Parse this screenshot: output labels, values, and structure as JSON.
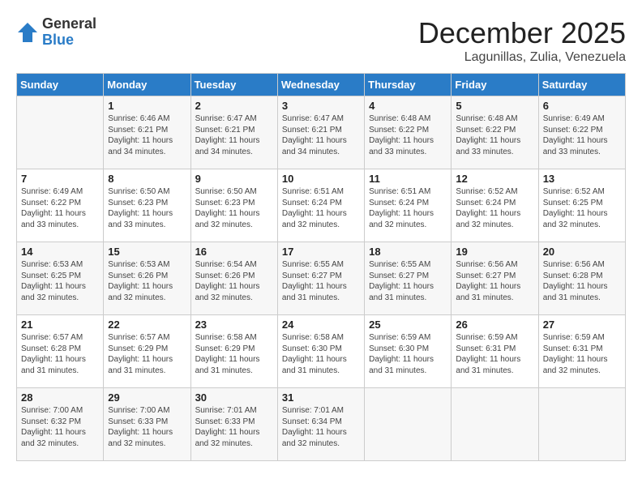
{
  "header": {
    "logo": {
      "general": "General",
      "blue": "Blue"
    },
    "title": "December 2025",
    "location": "Lagunillas, Zulia, Venezuela"
  },
  "calendar": {
    "days_of_week": [
      "Sunday",
      "Monday",
      "Tuesday",
      "Wednesday",
      "Thursday",
      "Friday",
      "Saturday"
    ],
    "weeks": [
      [
        {
          "day": "",
          "info": ""
        },
        {
          "day": "1",
          "info": "Sunrise: 6:46 AM\nSunset: 6:21 PM\nDaylight: 11 hours and 34 minutes."
        },
        {
          "day": "2",
          "info": "Sunrise: 6:47 AM\nSunset: 6:21 PM\nDaylight: 11 hours and 34 minutes."
        },
        {
          "day": "3",
          "info": "Sunrise: 6:47 AM\nSunset: 6:21 PM\nDaylight: 11 hours and 34 minutes."
        },
        {
          "day": "4",
          "info": "Sunrise: 6:48 AM\nSunset: 6:22 PM\nDaylight: 11 hours and 33 minutes."
        },
        {
          "day": "5",
          "info": "Sunrise: 6:48 AM\nSunset: 6:22 PM\nDaylight: 11 hours and 33 minutes."
        },
        {
          "day": "6",
          "info": "Sunrise: 6:49 AM\nSunset: 6:22 PM\nDaylight: 11 hours and 33 minutes."
        }
      ],
      [
        {
          "day": "7",
          "info": "Sunrise: 6:49 AM\nSunset: 6:22 PM\nDaylight: 11 hours and 33 minutes."
        },
        {
          "day": "8",
          "info": "Sunrise: 6:50 AM\nSunset: 6:23 PM\nDaylight: 11 hours and 33 minutes."
        },
        {
          "day": "9",
          "info": "Sunrise: 6:50 AM\nSunset: 6:23 PM\nDaylight: 11 hours and 32 minutes."
        },
        {
          "day": "10",
          "info": "Sunrise: 6:51 AM\nSunset: 6:24 PM\nDaylight: 11 hours and 32 minutes."
        },
        {
          "day": "11",
          "info": "Sunrise: 6:51 AM\nSunset: 6:24 PM\nDaylight: 11 hours and 32 minutes."
        },
        {
          "day": "12",
          "info": "Sunrise: 6:52 AM\nSunset: 6:24 PM\nDaylight: 11 hours and 32 minutes."
        },
        {
          "day": "13",
          "info": "Sunrise: 6:52 AM\nSunset: 6:25 PM\nDaylight: 11 hours and 32 minutes."
        }
      ],
      [
        {
          "day": "14",
          "info": "Sunrise: 6:53 AM\nSunset: 6:25 PM\nDaylight: 11 hours and 32 minutes."
        },
        {
          "day": "15",
          "info": "Sunrise: 6:53 AM\nSunset: 6:26 PM\nDaylight: 11 hours and 32 minutes."
        },
        {
          "day": "16",
          "info": "Sunrise: 6:54 AM\nSunset: 6:26 PM\nDaylight: 11 hours and 32 minutes."
        },
        {
          "day": "17",
          "info": "Sunrise: 6:55 AM\nSunset: 6:27 PM\nDaylight: 11 hours and 31 minutes."
        },
        {
          "day": "18",
          "info": "Sunrise: 6:55 AM\nSunset: 6:27 PM\nDaylight: 11 hours and 31 minutes."
        },
        {
          "day": "19",
          "info": "Sunrise: 6:56 AM\nSunset: 6:27 PM\nDaylight: 11 hours and 31 minutes."
        },
        {
          "day": "20",
          "info": "Sunrise: 6:56 AM\nSunset: 6:28 PM\nDaylight: 11 hours and 31 minutes."
        }
      ],
      [
        {
          "day": "21",
          "info": "Sunrise: 6:57 AM\nSunset: 6:28 PM\nDaylight: 11 hours and 31 minutes."
        },
        {
          "day": "22",
          "info": "Sunrise: 6:57 AM\nSunset: 6:29 PM\nDaylight: 11 hours and 31 minutes."
        },
        {
          "day": "23",
          "info": "Sunrise: 6:58 AM\nSunset: 6:29 PM\nDaylight: 11 hours and 31 minutes."
        },
        {
          "day": "24",
          "info": "Sunrise: 6:58 AM\nSunset: 6:30 PM\nDaylight: 11 hours and 31 minutes."
        },
        {
          "day": "25",
          "info": "Sunrise: 6:59 AM\nSunset: 6:30 PM\nDaylight: 11 hours and 31 minutes."
        },
        {
          "day": "26",
          "info": "Sunrise: 6:59 AM\nSunset: 6:31 PM\nDaylight: 11 hours and 31 minutes."
        },
        {
          "day": "27",
          "info": "Sunrise: 6:59 AM\nSunset: 6:31 PM\nDaylight: 11 hours and 32 minutes."
        }
      ],
      [
        {
          "day": "28",
          "info": "Sunrise: 7:00 AM\nSunset: 6:32 PM\nDaylight: 11 hours and 32 minutes."
        },
        {
          "day": "29",
          "info": "Sunrise: 7:00 AM\nSunset: 6:33 PM\nDaylight: 11 hours and 32 minutes."
        },
        {
          "day": "30",
          "info": "Sunrise: 7:01 AM\nSunset: 6:33 PM\nDaylight: 11 hours and 32 minutes."
        },
        {
          "day": "31",
          "info": "Sunrise: 7:01 AM\nSunset: 6:34 PM\nDaylight: 11 hours and 32 minutes."
        },
        {
          "day": "",
          "info": ""
        },
        {
          "day": "",
          "info": ""
        },
        {
          "day": "",
          "info": ""
        }
      ]
    ]
  }
}
